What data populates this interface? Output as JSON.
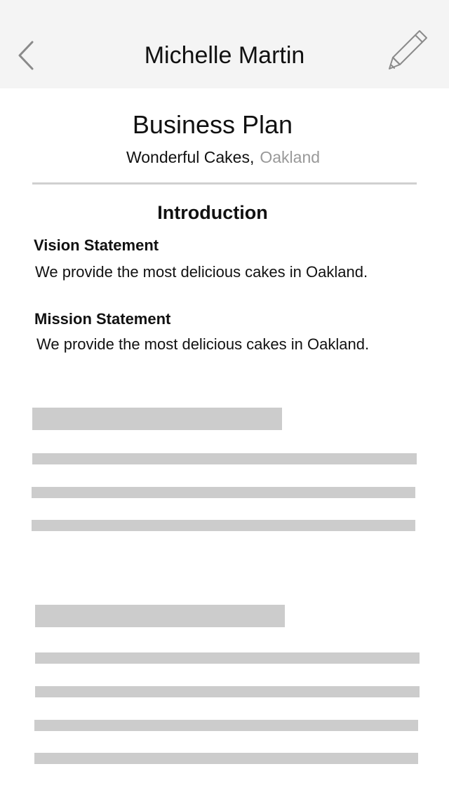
{
  "navbar": {
    "title": "Michelle Martin",
    "back_icon": "chevron-left-icon",
    "edit_icon": "pencil-icon"
  },
  "document": {
    "title": "Business Plan",
    "company": "Wonderful Cakes,",
    "city": "Oakland"
  },
  "introduction": {
    "heading": "Introduction",
    "vision": {
      "heading": "Vision Statement",
      "body": "We provide the most delicious cakes in Oakland."
    },
    "mission": {
      "heading": "Mission Statement",
      "body": "We provide the most delicious cakes in Oakland."
    }
  },
  "colors": {
    "navbar_background": "#f4f4f4",
    "placeholder": "#cccccc",
    "muted_text": "#999999",
    "divider": "#d0d0d0"
  }
}
